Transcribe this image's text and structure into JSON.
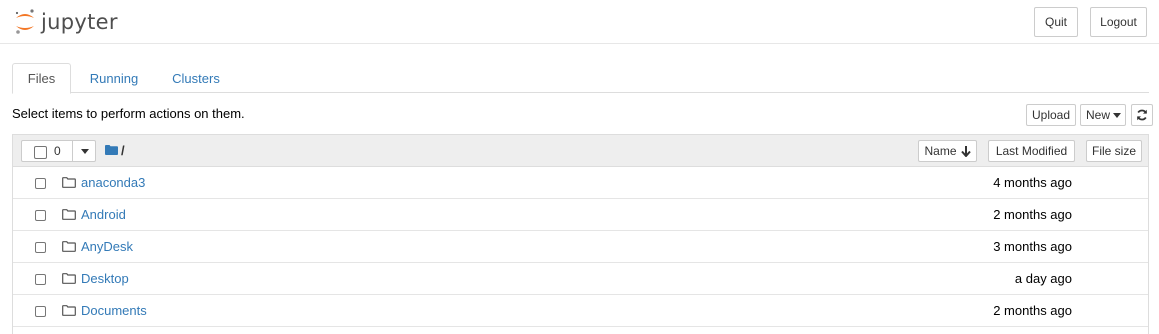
{
  "header": {
    "logo_text": "jupyter",
    "quit_label": "Quit",
    "logout_label": "Logout"
  },
  "tabs": [
    {
      "label": "Files",
      "active": true
    },
    {
      "label": "Running",
      "active": false
    },
    {
      "label": "Clusters",
      "active": false
    }
  ],
  "toolbar": {
    "hint": "Select items to perform actions on them.",
    "upload_label": "Upload",
    "new_label": "New",
    "refresh_icon": "refresh-icon"
  },
  "list_header": {
    "selected_count": "0",
    "path": "/",
    "sort_name_label": "Name",
    "last_modified_label": "Last Modified",
    "file_size_label": "File size"
  },
  "items": [
    {
      "name": "anaconda3",
      "modified": "4 months ago",
      "type": "folder"
    },
    {
      "name": "Android",
      "modified": "2 months ago",
      "type": "folder"
    },
    {
      "name": "AnyDesk",
      "modified": "3 months ago",
      "type": "folder"
    },
    {
      "name": "Desktop",
      "modified": "a day ago",
      "type": "folder"
    },
    {
      "name": "Documents",
      "modified": "2 months ago",
      "type": "folder"
    }
  ],
  "colors": {
    "link": "#337ab7",
    "logo_orange": "#f37726",
    "header_bg": "#eeeeee"
  }
}
